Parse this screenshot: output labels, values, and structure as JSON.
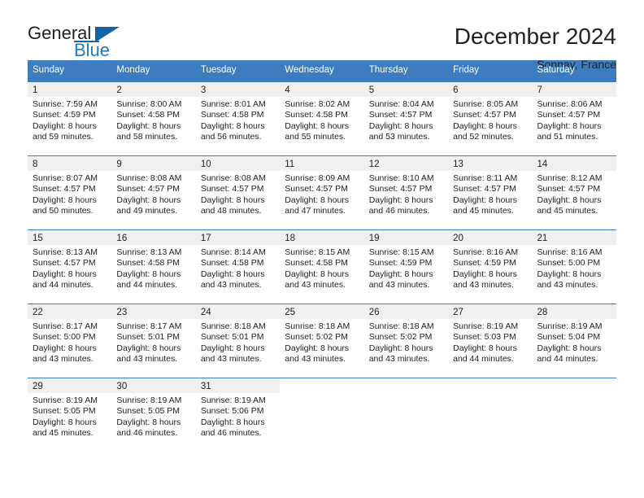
{
  "brand": {
    "name_part1": "General",
    "name_part2": "Blue",
    "accent_color": "#1f7ac4",
    "triangle_color": "#1363a5",
    "logo_icon": "triangle-flag-icon"
  },
  "header": {
    "title": "December 2024",
    "subtitle": "Sonnay, France"
  },
  "calendar": {
    "header_bg": "#3d7cbf",
    "header_text_color": "#ffffff",
    "day_band_bg": "#f0f0f0",
    "weekdays": [
      "Sunday",
      "Monday",
      "Tuesday",
      "Wednesday",
      "Thursday",
      "Friday",
      "Saturday"
    ],
    "weeks": [
      [
        {
          "day": "1",
          "sunrise": "Sunrise: 7:59 AM",
          "sunset": "Sunset: 4:59 PM",
          "daylight_line1": "Daylight: 8 hours",
          "daylight_line2": "and 59 minutes."
        },
        {
          "day": "2",
          "sunrise": "Sunrise: 8:00 AM",
          "sunset": "Sunset: 4:58 PM",
          "daylight_line1": "Daylight: 8 hours",
          "daylight_line2": "and 58 minutes."
        },
        {
          "day": "3",
          "sunrise": "Sunrise: 8:01 AM",
          "sunset": "Sunset: 4:58 PM",
          "daylight_line1": "Daylight: 8 hours",
          "daylight_line2": "and 56 minutes."
        },
        {
          "day": "4",
          "sunrise": "Sunrise: 8:02 AM",
          "sunset": "Sunset: 4:58 PM",
          "daylight_line1": "Daylight: 8 hours",
          "daylight_line2": "and 55 minutes."
        },
        {
          "day": "5",
          "sunrise": "Sunrise: 8:04 AM",
          "sunset": "Sunset: 4:57 PM",
          "daylight_line1": "Daylight: 8 hours",
          "daylight_line2": "and 53 minutes."
        },
        {
          "day": "6",
          "sunrise": "Sunrise: 8:05 AM",
          "sunset": "Sunset: 4:57 PM",
          "daylight_line1": "Daylight: 8 hours",
          "daylight_line2": "and 52 minutes."
        },
        {
          "day": "7",
          "sunrise": "Sunrise: 8:06 AM",
          "sunset": "Sunset: 4:57 PM",
          "daylight_line1": "Daylight: 8 hours",
          "daylight_line2": "and 51 minutes."
        }
      ],
      [
        {
          "day": "8",
          "sunrise": "Sunrise: 8:07 AM",
          "sunset": "Sunset: 4:57 PM",
          "daylight_line1": "Daylight: 8 hours",
          "daylight_line2": "and 50 minutes."
        },
        {
          "day": "9",
          "sunrise": "Sunrise: 8:08 AM",
          "sunset": "Sunset: 4:57 PM",
          "daylight_line1": "Daylight: 8 hours",
          "daylight_line2": "and 49 minutes."
        },
        {
          "day": "10",
          "sunrise": "Sunrise: 8:08 AM",
          "sunset": "Sunset: 4:57 PM",
          "daylight_line1": "Daylight: 8 hours",
          "daylight_line2": "and 48 minutes."
        },
        {
          "day": "11",
          "sunrise": "Sunrise: 8:09 AM",
          "sunset": "Sunset: 4:57 PM",
          "daylight_line1": "Daylight: 8 hours",
          "daylight_line2": "and 47 minutes."
        },
        {
          "day": "12",
          "sunrise": "Sunrise: 8:10 AM",
          "sunset": "Sunset: 4:57 PM",
          "daylight_line1": "Daylight: 8 hours",
          "daylight_line2": "and 46 minutes."
        },
        {
          "day": "13",
          "sunrise": "Sunrise: 8:11 AM",
          "sunset": "Sunset: 4:57 PM",
          "daylight_line1": "Daylight: 8 hours",
          "daylight_line2": "and 45 minutes."
        },
        {
          "day": "14",
          "sunrise": "Sunrise: 8:12 AM",
          "sunset": "Sunset: 4:57 PM",
          "daylight_line1": "Daylight: 8 hours",
          "daylight_line2": "and 45 minutes."
        }
      ],
      [
        {
          "day": "15",
          "sunrise": "Sunrise: 8:13 AM",
          "sunset": "Sunset: 4:57 PM",
          "daylight_line1": "Daylight: 8 hours",
          "daylight_line2": "and 44 minutes."
        },
        {
          "day": "16",
          "sunrise": "Sunrise: 8:13 AM",
          "sunset": "Sunset: 4:58 PM",
          "daylight_line1": "Daylight: 8 hours",
          "daylight_line2": "and 44 minutes."
        },
        {
          "day": "17",
          "sunrise": "Sunrise: 8:14 AM",
          "sunset": "Sunset: 4:58 PM",
          "daylight_line1": "Daylight: 8 hours",
          "daylight_line2": "and 43 minutes."
        },
        {
          "day": "18",
          "sunrise": "Sunrise: 8:15 AM",
          "sunset": "Sunset: 4:58 PM",
          "daylight_line1": "Daylight: 8 hours",
          "daylight_line2": "and 43 minutes."
        },
        {
          "day": "19",
          "sunrise": "Sunrise: 8:15 AM",
          "sunset": "Sunset: 4:59 PM",
          "daylight_line1": "Daylight: 8 hours",
          "daylight_line2": "and 43 minutes."
        },
        {
          "day": "20",
          "sunrise": "Sunrise: 8:16 AM",
          "sunset": "Sunset: 4:59 PM",
          "daylight_line1": "Daylight: 8 hours",
          "daylight_line2": "and 43 minutes."
        },
        {
          "day": "21",
          "sunrise": "Sunrise: 8:16 AM",
          "sunset": "Sunset: 5:00 PM",
          "daylight_line1": "Daylight: 8 hours",
          "daylight_line2": "and 43 minutes."
        }
      ],
      [
        {
          "day": "22",
          "sunrise": "Sunrise: 8:17 AM",
          "sunset": "Sunset: 5:00 PM",
          "daylight_line1": "Daylight: 8 hours",
          "daylight_line2": "and 43 minutes."
        },
        {
          "day": "23",
          "sunrise": "Sunrise: 8:17 AM",
          "sunset": "Sunset: 5:01 PM",
          "daylight_line1": "Daylight: 8 hours",
          "daylight_line2": "and 43 minutes."
        },
        {
          "day": "24",
          "sunrise": "Sunrise: 8:18 AM",
          "sunset": "Sunset: 5:01 PM",
          "daylight_line1": "Daylight: 8 hours",
          "daylight_line2": "and 43 minutes."
        },
        {
          "day": "25",
          "sunrise": "Sunrise: 8:18 AM",
          "sunset": "Sunset: 5:02 PM",
          "daylight_line1": "Daylight: 8 hours",
          "daylight_line2": "and 43 minutes."
        },
        {
          "day": "26",
          "sunrise": "Sunrise: 8:18 AM",
          "sunset": "Sunset: 5:02 PM",
          "daylight_line1": "Daylight: 8 hours",
          "daylight_line2": "and 43 minutes."
        },
        {
          "day": "27",
          "sunrise": "Sunrise: 8:19 AM",
          "sunset": "Sunset: 5:03 PM",
          "daylight_line1": "Daylight: 8 hours",
          "daylight_line2": "and 44 minutes."
        },
        {
          "day": "28",
          "sunrise": "Sunrise: 8:19 AM",
          "sunset": "Sunset: 5:04 PM",
          "daylight_line1": "Daylight: 8 hours",
          "daylight_line2": "and 44 minutes."
        }
      ],
      [
        {
          "day": "29",
          "sunrise": "Sunrise: 8:19 AM",
          "sunset": "Sunset: 5:05 PM",
          "daylight_line1": "Daylight: 8 hours",
          "daylight_line2": "and 45 minutes."
        },
        {
          "day": "30",
          "sunrise": "Sunrise: 8:19 AM",
          "sunset": "Sunset: 5:05 PM",
          "daylight_line1": "Daylight: 8 hours",
          "daylight_line2": "and 46 minutes."
        },
        {
          "day": "31",
          "sunrise": "Sunrise: 8:19 AM",
          "sunset": "Sunset: 5:06 PM",
          "daylight_line1": "Daylight: 8 hours",
          "daylight_line2": "and 46 minutes."
        },
        {
          "day": "",
          "sunrise": "",
          "sunset": "",
          "daylight_line1": "",
          "daylight_line2": ""
        },
        {
          "day": "",
          "sunrise": "",
          "sunset": "",
          "daylight_line1": "",
          "daylight_line2": ""
        },
        {
          "day": "",
          "sunrise": "",
          "sunset": "",
          "daylight_line1": "",
          "daylight_line2": ""
        },
        {
          "day": "",
          "sunrise": "",
          "sunset": "",
          "daylight_line1": "",
          "daylight_line2": ""
        }
      ]
    ]
  }
}
